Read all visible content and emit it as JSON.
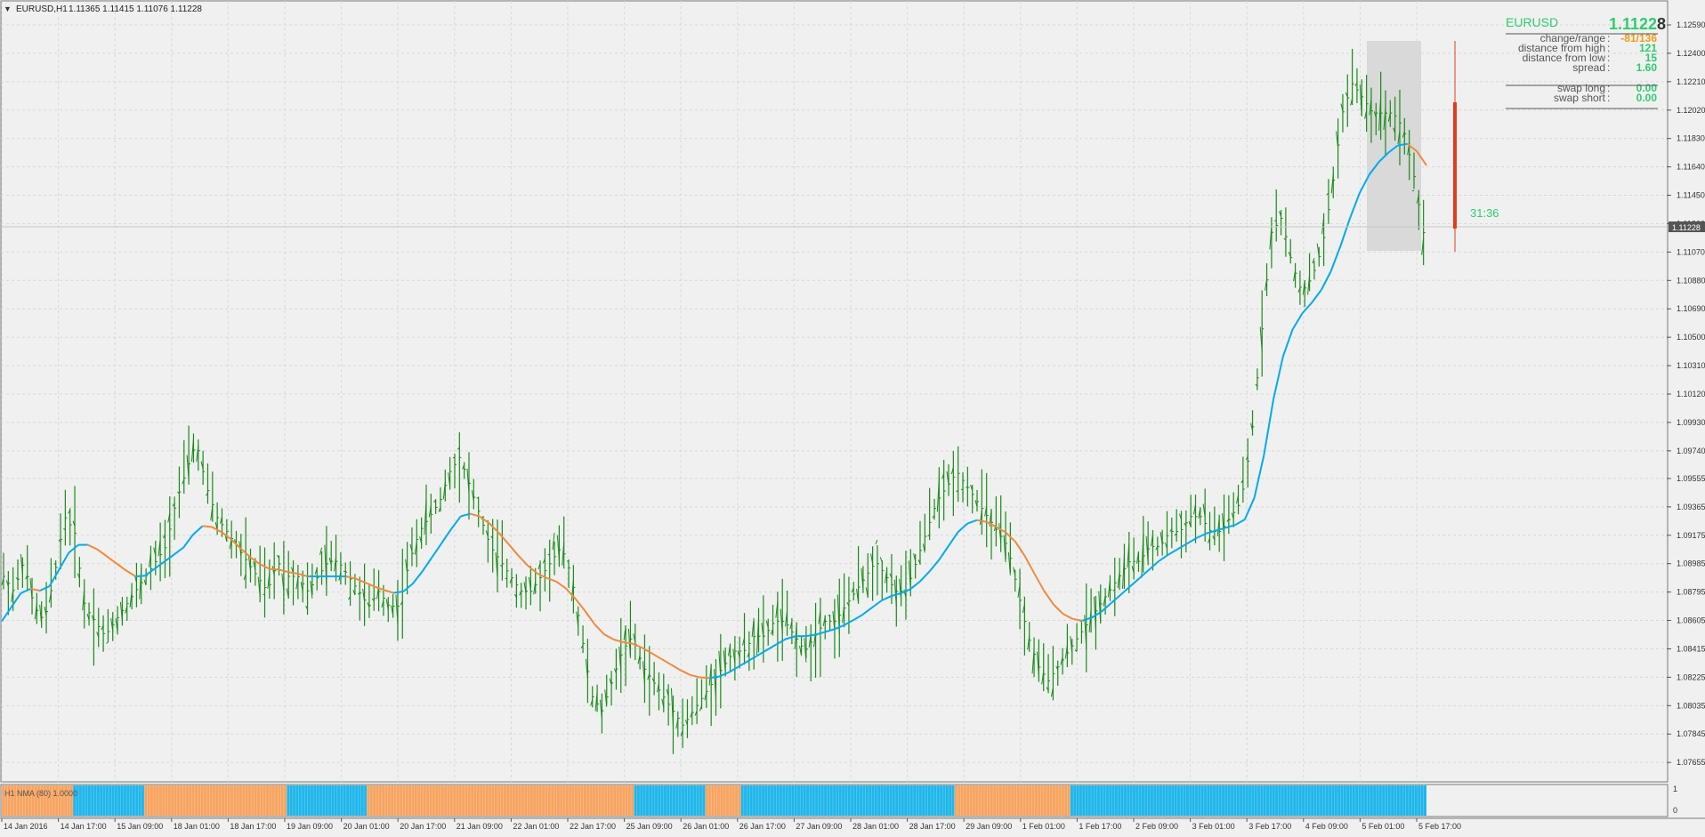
{
  "chart_header": {
    "symbol": "EURUSD,H1",
    "ohlc": "1.11365 1.11415 1.11076 1.11228"
  },
  "info_panel": {
    "symbol": "EURUSD",
    "price_main": "1.1122",
    "price_last_digit": "8",
    "rows": [
      {
        "label": "change/range",
        "value": "-81/136",
        "value_color": "#f39c12"
      },
      {
        "label": "distance from high",
        "value": "121",
        "value_color": "#2ecc71"
      },
      {
        "label": "distance from low",
        "value": "15",
        "value_color": "#2ecc71"
      },
      {
        "label": "spread",
        "value": "1.60",
        "value_color": "#2ecc71"
      },
      {
        "label": "swap long",
        "value": "0.00",
        "value_color": "#2ecc71"
      },
      {
        "label": "swap short",
        "value": "0.00",
        "value_color": "#2ecc71"
      }
    ]
  },
  "timer": "31:36",
  "current_price_tag": "1.11228",
  "price_axis": [
    "1.12590",
    "1.12400",
    "1.12210",
    "1.12020",
    "1.11830",
    "1.11640",
    "1.11450",
    "1.11260",
    "1.11070",
    "1.10880",
    "1.10690",
    "1.10500",
    "1.10310",
    "1.10120",
    "1.09930",
    "1.09740",
    "1.09555",
    "1.09365",
    "1.09175",
    "1.08985",
    "1.08795",
    "1.08605",
    "1.08415",
    "1.08225",
    "1.08035",
    "1.07845",
    "1.07655"
  ],
  "time_axis": [
    "14 Jan 2016",
    "14 Jan 17:00",
    "15 Jan 09:00",
    "18 Jan 01:00",
    "18 Jan 17:00",
    "19 Jan 09:00",
    "20 Jan 01:00",
    "20 Jan 17:00",
    "21 Jan 09:00",
    "22 Jan 01:00",
    "22 Jan 17:00",
    "25 Jan 09:00",
    "26 Jan 01:00",
    "26 Jan 17:00",
    "27 Jan 09:00",
    "28 Jan 01:00",
    "28 Jan 17:00",
    "29 Jan 09:00",
    "1 Feb 01:00",
    "1 Feb 17:00",
    "2 Feb 09:00",
    "3 Feb 01:00",
    "3 Feb 17:00",
    "4 Feb 09:00",
    "5 Feb 01:00",
    "5 Feb 17:00"
  ],
  "sub_window": {
    "label": "H1 NMA (80) 1.0000",
    "axis": [
      "1",
      "0"
    ],
    "segments": [
      {
        "color": "orange",
        "bars": 8
      },
      {
        "color": "blue",
        "bars": 8
      },
      {
        "color": "orange",
        "bars": 16
      },
      {
        "color": "blue",
        "bars": 9
      },
      {
        "color": "orange",
        "bars": 30
      },
      {
        "color": "blue",
        "bars": 8
      },
      {
        "color": "orange",
        "bars": 4
      },
      {
        "color": "blue",
        "bars": 24
      },
      {
        "color": "orange",
        "bars": 13
      },
      {
        "color": "blue",
        "bars": 40
      }
    ]
  },
  "colors": {
    "bar": "#1a8a1a",
    "ma_up": "#00aaee",
    "ma_down": "#f08a3c",
    "hist_blue": "#1fb6ea",
    "hist_orange": "#f6a460",
    "candle_red": "#e83a1a",
    "timer_green": "#2ecc71"
  },
  "chart_data": {
    "type": "line",
    "series": [
      {
        "values": [
          1.089,
          1.088,
          1.09,
          1.087,
          1.086,
          1.089,
          1.093,
          1.092,
          1.087,
          1.086,
          1.085,
          1.086,
          1.087,
          1.088,
          1.089,
          1.09,
          1.091,
          1.094,
          1.096,
          1.098,
          1.095,
          1.093,
          1.092,
          1.091,
          1.09,
          1.089,
          1.088,
          1.09,
          1.089,
          1.089,
          1.088,
          1.089,
          1.09,
          1.09,
          1.089,
          1.088,
          1.087,
          1.088,
          1.087,
          1.087,
          1.09,
          1.092,
          1.093,
          1.094,
          1.096,
          1.097,
          1.095,
          1.093,
          1.091,
          1.09,
          1.089,
          1.088,
          1.088,
          1.089,
          1.09,
          1.091,
          1.089,
          1.085,
          1.081,
          1.08,
          1.082,
          1.084,
          1.085,
          1.083,
          1.082,
          1.081,
          1.08,
          1.079,
          1.08,
          1.081,
          1.082,
          1.083,
          1.084,
          1.084,
          1.085,
          1.085,
          1.086,
          1.086,
          1.085,
          1.084,
          1.085,
          1.086,
          1.086,
          1.087,
          1.088,
          1.089,
          1.09,
          1.089,
          1.088,
          1.088,
          1.09,
          1.092,
          1.094,
          1.095,
          1.096,
          1.095,
          1.094,
          1.093,
          1.092,
          1.091,
          1.088,
          1.085,
          1.083,
          1.082,
          1.083,
          1.084,
          1.085,
          1.086,
          1.087,
          1.088,
          1.089,
          1.09,
          1.09,
          1.091,
          1.091,
          1.092,
          1.092,
          1.093,
          1.093,
          1.092,
          1.092,
          1.093,
          1.094,
          1.098,
          1.105,
          1.112,
          1.113,
          1.11,
          1.108,
          1.109,
          1.111,
          1.115,
          1.12,
          1.122,
          1.121,
          1.12,
          1.12,
          1.12,
          1.119,
          1.116,
          1.112
        ],
        "ma_values": [
          1.086,
          1.087,
          1.088,
          1.0882,
          1.088,
          1.0885,
          1.09,
          1.091,
          1.0912,
          1.091,
          1.0905,
          1.09,
          1.0895,
          1.089,
          1.089,
          1.0895,
          1.09,
          1.0905,
          1.091,
          1.092,
          1.0925,
          1.0922,
          1.0918,
          1.0912,
          1.0905,
          1.09,
          1.0895,
          1.0895,
          1.0893,
          1.0892,
          1.089,
          1.089,
          1.089,
          1.089,
          1.089,
          1.0888,
          1.0885,
          1.0882,
          1.088,
          1.0878,
          1.0882,
          1.089,
          1.09,
          1.091,
          1.092,
          1.093,
          1.0932,
          1.093,
          1.0925,
          1.0918,
          1.091,
          1.0902,
          1.0895,
          1.089,
          1.0888,
          1.0885,
          1.0878,
          1.087,
          1.086,
          1.0852,
          1.0848,
          1.0846,
          1.0845,
          1.0842,
          1.0838,
          1.0834,
          1.083,
          1.0826,
          1.0823,
          1.0822,
          1.0822,
          1.0824,
          1.0828,
          1.0832,
          1.0836,
          1.084,
          1.0844,
          1.0848,
          1.085,
          1.085,
          1.0851,
          1.0853,
          1.0855,
          1.0858,
          1.0862,
          1.0866,
          1.0872,
          1.0876,
          1.0878,
          1.088,
          1.0885,
          1.0892,
          1.09,
          1.091,
          1.092,
          1.0926,
          1.0928,
          1.0926,
          1.0922,
          1.0918,
          1.091,
          1.0898,
          1.0885,
          1.0874,
          1.0866,
          1.0862,
          1.086,
          1.0862,
          1.0866,
          1.0872,
          1.0878,
          1.0884,
          1.089,
          1.0896,
          1.0902,
          1.0906,
          1.091,
          1.0914,
          1.0918,
          1.092,
          1.0922,
          1.0924,
          1.0926,
          1.094,
          1.097,
          1.101,
          1.104,
          1.1058,
          1.1068,
          1.1075,
          1.1085,
          1.11,
          1.112,
          1.114,
          1.1155,
          1.1165,
          1.1172,
          1.1178,
          1.118,
          1.1175,
          1.1165
        ]
      }
    ],
    "ylim": [
      1.0765,
      1.1259
    ]
  }
}
